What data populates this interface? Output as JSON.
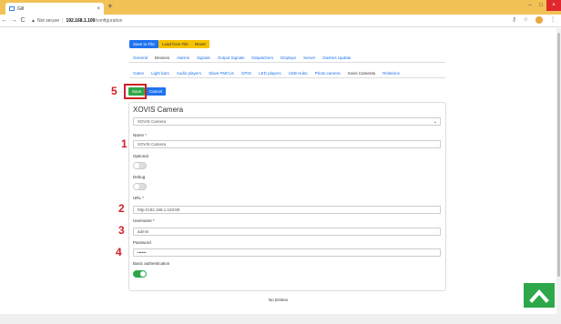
{
  "browser": {
    "tab_title": "Gill",
    "new_tab": "+",
    "nav": {
      "back": "←",
      "forward": "→",
      "reload": "C"
    },
    "address": {
      "warning_icon": "warning-triangle-icon",
      "not_secure": "Not secure",
      "separator": "|",
      "host": "192.168.1.100",
      "path": "/configuration"
    },
    "window_controls": {
      "minimize": "–",
      "maximize": "□",
      "close": "×"
    }
  },
  "toolbar": {
    "save_to_file": "Save to File",
    "load_from_file": "Load from File",
    "reset": "Reset"
  },
  "main_tabs": [
    "General",
    "Devices",
    "Alarms",
    "Signals",
    "Output Signals",
    "Dispatchers",
    "Displays",
    "Server",
    "Dashes Update"
  ],
  "main_tab_active": "Devices",
  "device_tabs": [
    "Gates",
    "Light bars",
    "Audio players",
    "Slave FMCUs",
    "GPIO",
    "LED players",
    "USB Hubs",
    "Photo camera",
    "Xovis Cameras",
    "Relations"
  ],
  "device_tab_active": "Xovis Cameras",
  "actions": {
    "save": "Save",
    "cancel": "Cancel"
  },
  "form": {
    "title": "XOVIS Camera",
    "select_value": "XOVIS Camera",
    "name_label": "Name *",
    "name_value": "XOVIS Camera",
    "optional_label": "Optional",
    "optional_on": false,
    "debug_label": "Debug",
    "debug_on": false,
    "url_label": "URL *",
    "url_value": "http://192.168.1.103:80",
    "username_label": "Username *",
    "username_value": "admin",
    "password_label": "Password",
    "password_value": "••••••",
    "basic_auth_label": "Basic authentication",
    "basic_auth_on": true
  },
  "annotations": [
    "1",
    "2",
    "3",
    "4",
    "5"
  ],
  "footer": {
    "no_entries": "No Entries"
  },
  "colors": {
    "primary": "#1e73f0",
    "success": "#2ea74a",
    "warning": "#f7c200",
    "annotation": "#d21f26",
    "titlebar": "#f2c257"
  }
}
